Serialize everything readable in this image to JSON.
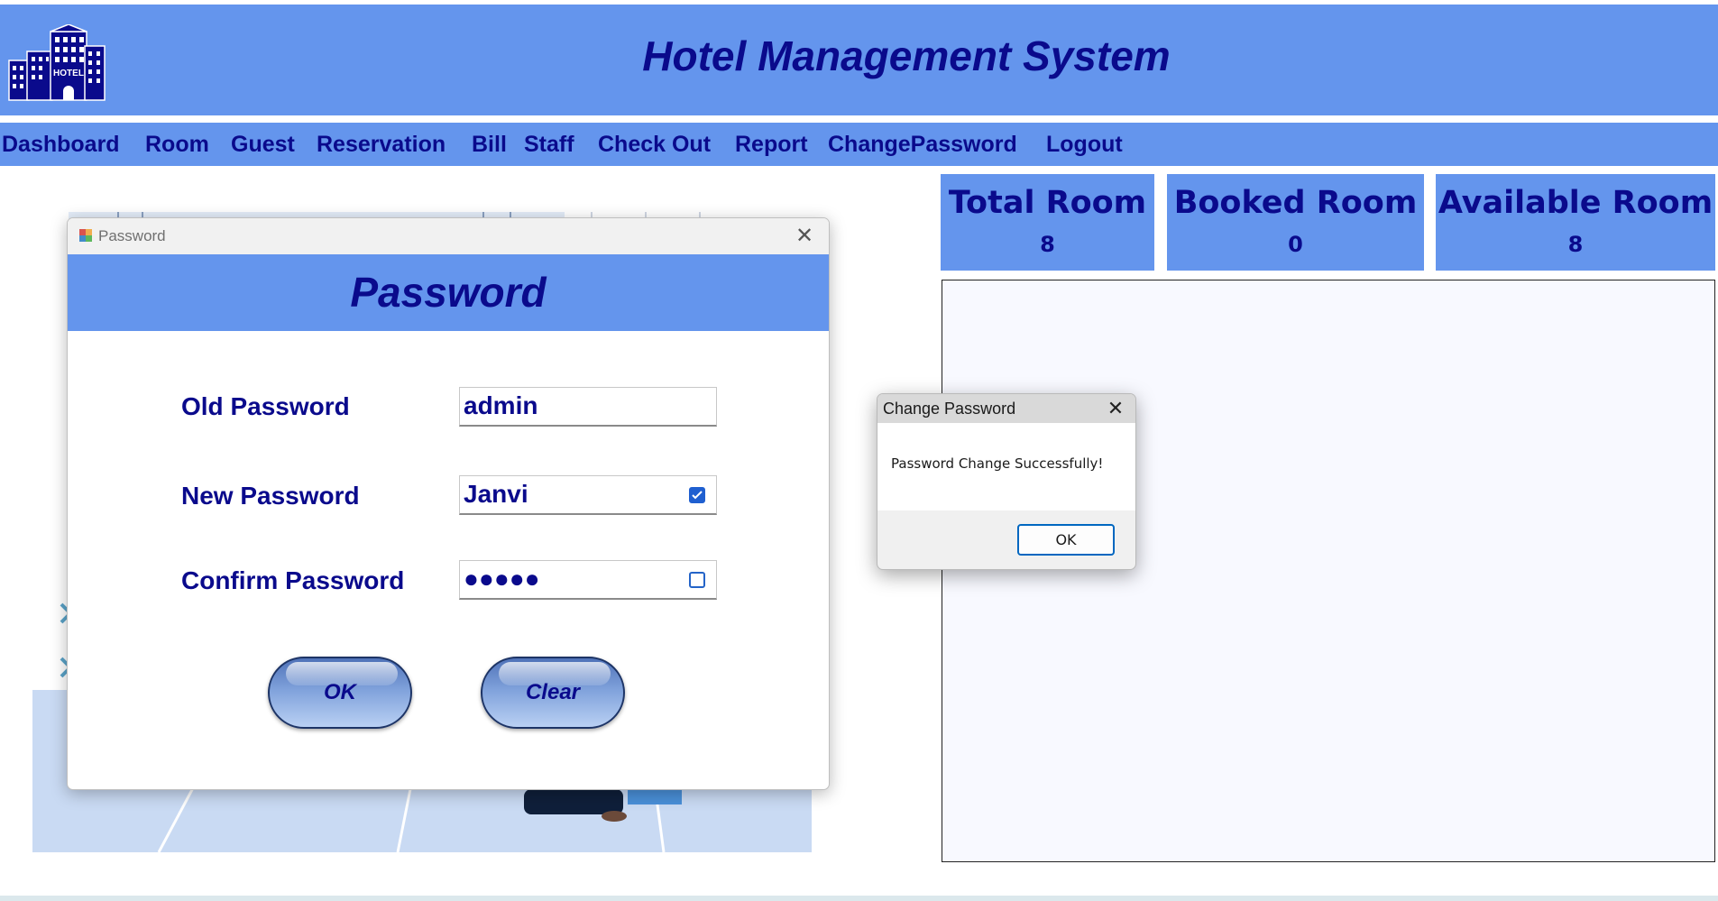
{
  "app": {
    "title": "Hotel Management System",
    "logo_text": "HOTEL"
  },
  "menu": {
    "items": [
      "Dashboard",
      "Room",
      "Guest",
      "Reservation",
      "Bill",
      "Staff",
      "Check Out",
      "Report",
      "ChangePassword",
      "Logout"
    ]
  },
  "stats": {
    "total": {
      "label": "Total Room",
      "value": "8"
    },
    "booked": {
      "label": "Booked Room",
      "value": "0"
    },
    "available": {
      "label": "Available Room",
      "value": "8"
    }
  },
  "password_window": {
    "window_title": "Password",
    "banner": "Password",
    "old_label": "Old Password",
    "old_value": "admin",
    "new_label": "New Password",
    "new_value": "Janvi",
    "new_show_checked": true,
    "confirm_label": "Confirm Password",
    "confirm_value": "●●●●●",
    "confirm_show_checked": false,
    "ok_label": "OK",
    "clear_label": "Clear"
  },
  "message_box": {
    "title": "Change Password",
    "text": "Password Change Successfully!",
    "ok_label": "OK"
  },
  "colors": {
    "header_bg": "#6495ed",
    "text_navy": "#0a0a8c"
  }
}
